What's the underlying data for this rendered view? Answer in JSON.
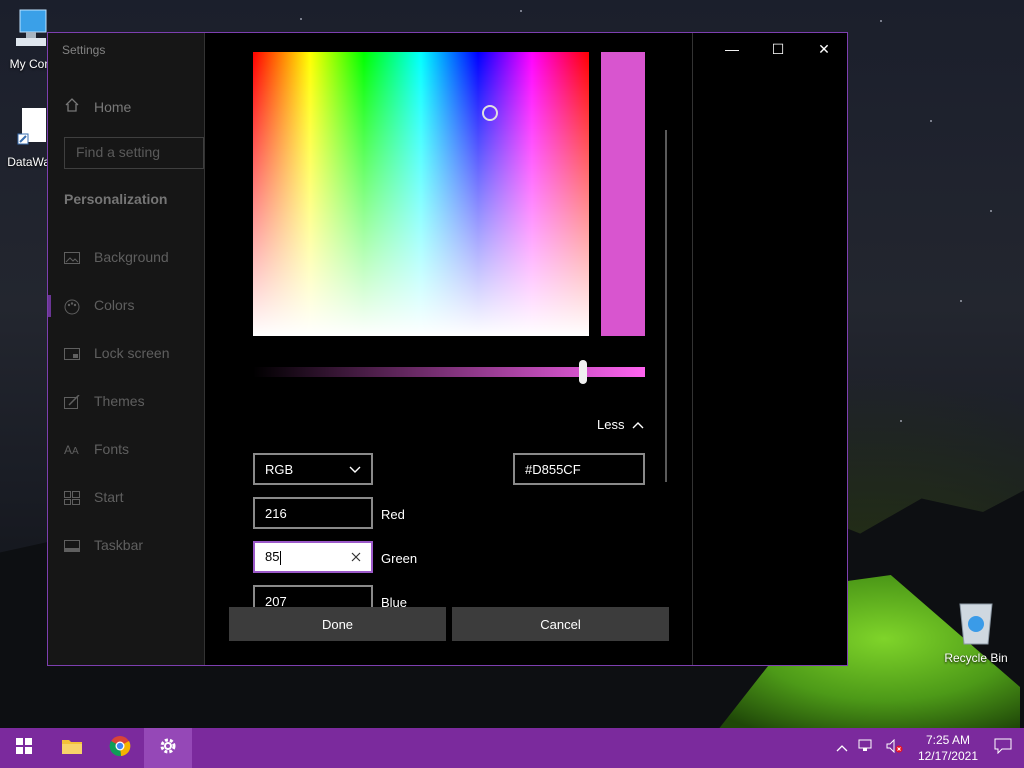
{
  "desktop": {
    "icons": [
      {
        "label": "My Com"
      },
      {
        "label": "DataWag"
      },
      {
        "label": "Recycle Bin"
      }
    ]
  },
  "window": {
    "app_title": "Settings",
    "controls": {
      "minimize": "—",
      "maximize": "☐",
      "close": "✕"
    }
  },
  "sidebar": {
    "home": "Home",
    "search_placeholder": "Find a setting",
    "section": "Personalization",
    "items": [
      {
        "label": "Background",
        "icon": "picture-icon"
      },
      {
        "label": "Colors",
        "icon": "palette-icon",
        "selected": true
      },
      {
        "label": "Lock screen",
        "icon": "lock-screen-icon"
      },
      {
        "label": "Themes",
        "icon": "themes-icon"
      },
      {
        "label": "Fonts",
        "icon": "fonts-icon"
      },
      {
        "label": "Start",
        "icon": "start-icon"
      },
      {
        "label": "Taskbar",
        "icon": "taskbar-icon"
      }
    ]
  },
  "color_picker": {
    "current_color": "#D855CF",
    "less_label": "Less",
    "mode": "RGB",
    "hex": "#D855CF",
    "fields": [
      {
        "label": "Red",
        "value": "216"
      },
      {
        "label": "Green",
        "value": "85"
      },
      {
        "label": "Blue",
        "value": "207"
      }
    ],
    "done": "Done",
    "cancel": "Cancel"
  },
  "taskbar": {
    "time": "7:25 AM",
    "date": "12/17/2021",
    "color": "#7b2a9d"
  }
}
